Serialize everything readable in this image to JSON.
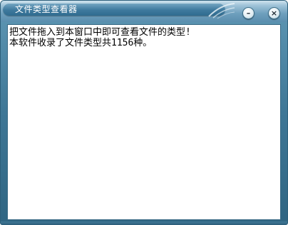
{
  "window": {
    "title": "文件类型查看器",
    "min_button_glyph": "–",
    "close_button_glyph": "×"
  },
  "content": {
    "lines": [
      "把文件拖入到本窗口中即可查看文件的类型!",
      "本软件收录了文件类型共1156种。"
    ]
  },
  "colors": {
    "frame": "#3f7796",
    "titlebar": "#6e9fbd",
    "content_background": "#ffffff"
  }
}
